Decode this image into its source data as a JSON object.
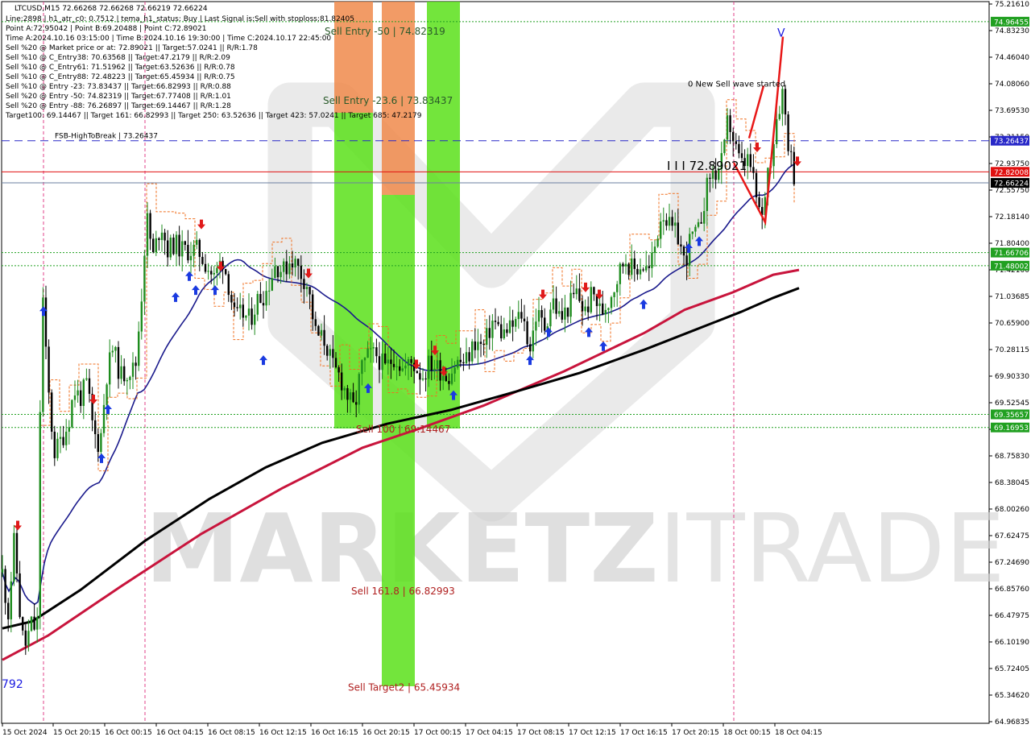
{
  "header": {
    "symbol_line": "LTCUSD,M15  72.66268 72.66268 72.66219 72.66224",
    "info_lines": [
      "Line:2898 | h1_atr_c0: 0.7512 | tema_h1_status: Buy | Last Signal is:Sell with stoploss:81.82405",
      "Point A:72.95042 | Point B:69.20488 | Point C:72.89021",
      "Time A:2024.10.16 03:15:00 | Time B:2024.10.16 19:30:00 | Time C:2024.10.17 22:45:00",
      "Sell %20 @ Market price or at: 72.89021 || Target:57.0241 || R/R:1.78",
      "Sell %10 @ C_Entry38: 70.63568 || Target:47.2179 || R/R:2.09",
      "Sell %10 @ C_Entry61: 71.51962 || Target:63.52636 || R/R:0.78",
      "Sell %10 @ C_Entry88: 72.48223 || Target:65.45934 || R/R:0.75",
      "Sell %10 @ Entry -23: 73.83437 || Target:66.82993 || R/R:0.88",
      "Sell %20 @ Entry -50: 74.82319 || Target:67.77408 || R/R:1.01",
      "Sell %20 @ Entry -88: 76.26897 || Target:69.14467 || R/R:1.28",
      "Target100: 69.14467 || Target 161: 66.82993 || Target 250: 63.52636 || Target 423: 57.0241 || Target 685: 47.2179"
    ]
  },
  "chart_data": {
    "type": "candlestick",
    "title": "LTCUSD,M15",
    "ylim": [
      64.96835,
      75.2161
    ],
    "y_ticks": [
      "75.21610",
      "74.83230",
      "74.46040",
      "74.08060",
      "73.69530",
      "73.31150",
      "72.93750",
      "72.55750",
      "72.18140",
      "71.80400",
      "71.42100",
      "71.03685",
      "70.65900",
      "70.28115",
      "69.90330",
      "69.52545",
      "69.14760",
      "68.75830",
      "68.38045",
      "68.00260",
      "67.62475",
      "67.24690",
      "66.85760",
      "66.47975",
      "66.10190",
      "65.72405",
      "65.34620",
      "64.96835"
    ],
    "x_ticks": [
      "15 Oct 2024",
      "15 Oct 20:15",
      "16 Oct 00:15",
      "16 Oct 04:15",
      "16 Oct 08:15",
      "16 Oct 12:15",
      "16 Oct 16:15",
      "16 Oct 20:15",
      "17 Oct 00:15",
      "17 Oct 04:15",
      "17 Oct 08:15",
      "17 Oct 12:15",
      "17 Oct 16:15",
      "17 Oct 20:15",
      "18 Oct 00:15",
      "18 Oct 04:15"
    ],
    "price_tags": [
      {
        "value": 74.96455,
        "label": "74.96455",
        "color": "#21a021"
      },
      {
        "value": 73.26437,
        "label": "73.26437",
        "color": "#2828c8"
      },
      {
        "value": 72.82008,
        "label": "72.82008",
        "color": "#e01010"
      },
      {
        "value": 72.66224,
        "label": "72.66224",
        "color": "#000000"
      },
      {
        "value": 71.66706,
        "label": "71.66706",
        "color": "#21a021"
      },
      {
        "value": 71.48002,
        "label": "71.48002",
        "color": "#21a021"
      },
      {
        "value": 69.35657,
        "label": "69.35657",
        "color": "#21a021"
      },
      {
        "value": 69.16953,
        "label": "69.16953",
        "color": "#21a021"
      }
    ],
    "horizontal_levels": [
      {
        "value": 74.96455,
        "color": "#21a021",
        "style": "dotted"
      },
      {
        "value": 73.26437,
        "color": "#2828c8",
        "style": "dashed",
        "label": "FSB-HighToBreak | 73.26437"
      },
      {
        "value": 72.82008,
        "color": "#e01010",
        "style": "solid"
      },
      {
        "value": 72.66224,
        "color": "#6b7fa0",
        "style": "solid"
      },
      {
        "value": 71.66706,
        "color": "#21a021",
        "style": "dotted"
      },
      {
        "value": 71.48002,
        "color": "#21a021",
        "style": "dotted"
      },
      {
        "value": 69.35657,
        "color": "#21a021",
        "style": "dotted"
      },
      {
        "value": 69.16953,
        "color": "#21a021",
        "style": "dotted"
      }
    ],
    "zone_labels": [
      {
        "text": "Sell Entry -50 | 74.82319",
        "value": 74.82319,
        "color": "#2a5a2a"
      },
      {
        "text": "Sell Entry -23.6 | 73.83437",
        "value": 73.83437,
        "color": "#2a5a2a"
      },
      {
        "text": "Sell 100 | 69.14467",
        "value": 69.14467,
        "color": "#b02020"
      },
      {
        "text": "Sell 161.8 | 66.82993",
        "value": 66.82993,
        "color": "#b02020"
      },
      {
        "text": "Sell Target2 | 65.45934",
        "value": 65.45934,
        "color": "#b02020"
      }
    ],
    "annotations": [
      {
        "text": "0 New Sell wave started",
        "value": 74.0806
      },
      {
        "text": "I I I 72.89021",
        "value": 72.89021
      },
      {
        "text": "792",
        "value": 65.5
      }
    ],
    "watermark": "MARKETZITRADE",
    "colors": {
      "bull": "#1e8c1e",
      "bear": "#000000",
      "ema_blue": "#1a1a8c",
      "ema_red": "#c8143c",
      "ema_black": "#000000",
      "zone_orange": "#f08a4b",
      "zone_green": "#5ae01a"
    }
  }
}
